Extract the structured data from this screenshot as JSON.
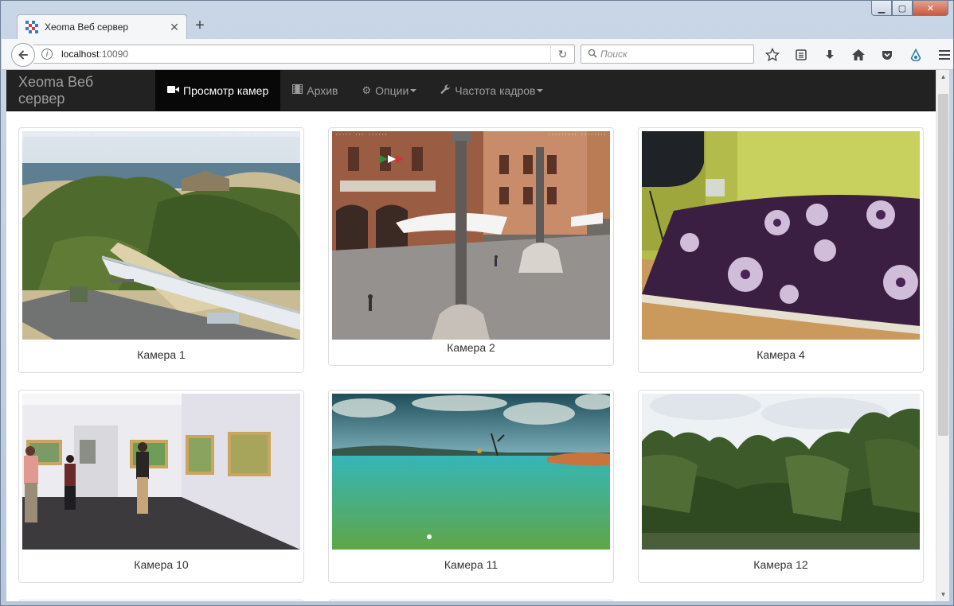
{
  "browser": {
    "tab_title": "Xeoma Веб сервер",
    "url_host": "localhost",
    "url_port": ":10090",
    "search_placeholder": "Поиск"
  },
  "app": {
    "brand": "Xeoma Веб сервер",
    "nav": [
      {
        "label": "Просмотр камер",
        "icon": "video-camera-icon",
        "active": true
      },
      {
        "label": "Архив",
        "icon": "film-icon"
      },
      {
        "label": "Опции",
        "icon": "gear-icon",
        "dropdown": true
      },
      {
        "label": "Частота кадров",
        "icon": "wrench-icon",
        "dropdown": true
      }
    ]
  },
  "cameras": [
    {
      "caption": "Камера 1",
      "scene": "beach-balcony"
    },
    {
      "caption": "Камера 2",
      "scene": "town-square-columns"
    },
    {
      "caption": "Камера 4",
      "scene": "purple-floral-pillow"
    },
    {
      "caption": "Камера 10",
      "scene": "art-gallery"
    },
    {
      "caption": "Камера 11",
      "scene": "turquoise-lake"
    },
    {
      "caption": "Камера 12",
      "scene": "tree-canopy"
    }
  ]
}
